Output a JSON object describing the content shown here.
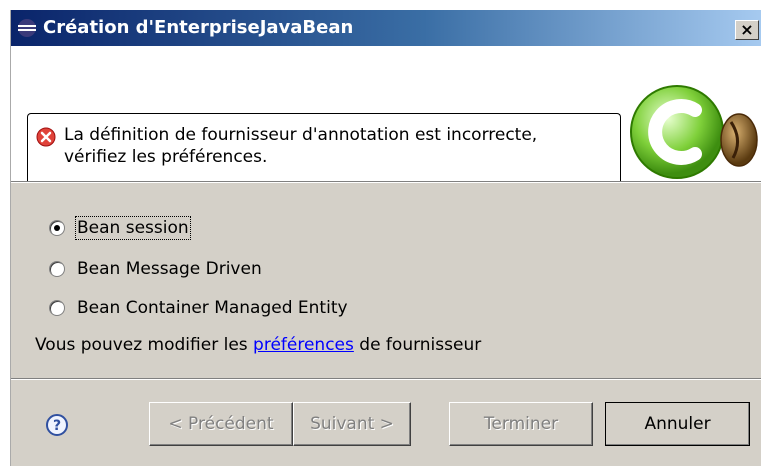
{
  "window": {
    "title": "Création d'EnterpriseJavaBean",
    "close_label": "×"
  },
  "message": {
    "text_line1": "La définition de fournisseur d'annotation est incorrecte,",
    "text_line2": "vérifiez les préférences.",
    "icon": "error-icon"
  },
  "options": [
    {
      "label": "Bean session",
      "checked": true
    },
    {
      "label": "Bean Message Driven",
      "checked": false
    },
    {
      "label": "Bean Container Managed Entity",
      "checked": false
    }
  ],
  "preferences_text": {
    "before": "Vous pouvez modifier les ",
    "link": "préférences",
    "after": " de fournisseur"
  },
  "buttons": {
    "back": "< Précédent",
    "next": "Suivant >",
    "finish": "Terminer",
    "cancel": "Annuler"
  },
  "colors": {
    "title_start": "#0a246a",
    "title_end": "#a6caf0",
    "dialog_bg": "#d4d0c8",
    "link": "#0000ff",
    "error": "#e0433a"
  }
}
